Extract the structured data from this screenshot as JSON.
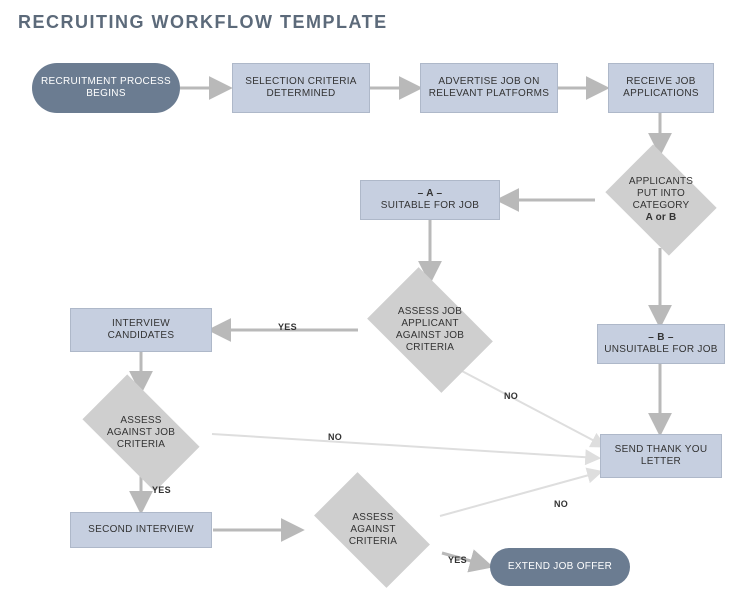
{
  "title": "RECRUITING WORKFLOW TEMPLATE",
  "colors": {
    "accentPill": "#6b7c91",
    "rectFill": "#c6cfe0",
    "rectBorder": "#aeb8c9",
    "diamondFill": "#cfcfcf",
    "arrow": "#b9b9b9",
    "arrowLight": "#dedede",
    "text": "#333333",
    "titleText": "#5c6a7a"
  },
  "nodes": {
    "start": {
      "type": "pill",
      "text": "RECRUITMENT PROCESS BEGINS"
    },
    "criteria": {
      "type": "rect",
      "text": "SELECTION CRITERIA DETERMINED"
    },
    "advertise": {
      "type": "rect",
      "text": "ADVERTISE JOB ON RELEVANT PLATFORMS"
    },
    "receive": {
      "type": "rect",
      "text": "RECEIVE JOB APPLICATIONS"
    },
    "categorize": {
      "type": "diamond",
      "text_lines": [
        "APPLICANTS",
        "PUT INTO",
        "CATEGORY"
      ],
      "bold_suffix": "A or B"
    },
    "catA": {
      "type": "rect",
      "text_lines": [
        "– A –",
        "SUITABLE FOR JOB"
      ]
    },
    "catB": {
      "type": "rect",
      "text_lines": [
        "– B –",
        "UNSUITABLE FOR JOB"
      ]
    },
    "assessA": {
      "type": "diamond",
      "text_lines": [
        "ASSESS JOB",
        "APPLICANT",
        "AGAINST JOB",
        "CRITERIA"
      ]
    },
    "interview": {
      "type": "rect",
      "text_lines": [
        "INTERVIEW",
        "CANDIDATES"
      ]
    },
    "assess2": {
      "type": "diamond",
      "text_lines": [
        "ASSESS",
        "AGAINST JOB",
        "CRITERIA"
      ]
    },
    "second": {
      "type": "rect",
      "text": "SECOND INTERVIEW"
    },
    "assess3": {
      "type": "diamond",
      "text_lines": [
        "ASSESS",
        "AGAINST",
        "CRITERIA"
      ]
    },
    "thanks": {
      "type": "rect",
      "text_lines": [
        "SEND THANK YOU",
        "LETTER"
      ]
    },
    "offer": {
      "type": "pill",
      "text": "EXTEND JOB OFFER"
    }
  },
  "labels": {
    "yes": "YES",
    "no": "NO"
  }
}
